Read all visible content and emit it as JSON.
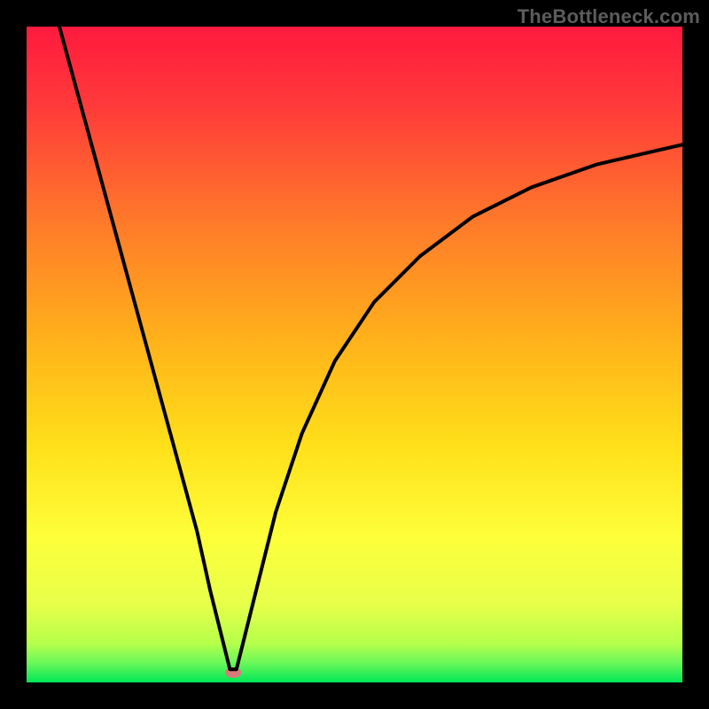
{
  "watermark": "TheBottleneck.com",
  "chart_data": {
    "type": "line",
    "title": "",
    "xlabel": "",
    "ylabel": "",
    "xlim": [
      0,
      100
    ],
    "ylim": [
      0,
      100
    ],
    "grid": false,
    "legend": false,
    "background_gradient": {
      "top_color": "#ff1a3e",
      "mid_colors": [
        "#ff8a2a",
        "#ffd61a",
        "#f6ff3a"
      ],
      "bottom_color": "#00e756"
    },
    "bottom_marker": {
      "x": 31.5,
      "y": 1.5,
      "color": "#d87a7a",
      "rx": 9,
      "ry": 6
    },
    "series": [
      {
        "name": "curve",
        "x": [
          5,
          8,
          11,
          14,
          17,
          20,
          23,
          26,
          28,
          30,
          31,
          32,
          33,
          35,
          38,
          42,
          47,
          53,
          60,
          68,
          77,
          87,
          100
        ],
        "y": [
          100,
          89,
          78,
          67,
          56,
          45,
          34,
          23,
          14,
          6,
          2,
          2,
          6,
          14,
          26,
          38,
          49,
          58,
          65,
          71,
          75.5,
          79,
          82
        ]
      }
    ]
  }
}
